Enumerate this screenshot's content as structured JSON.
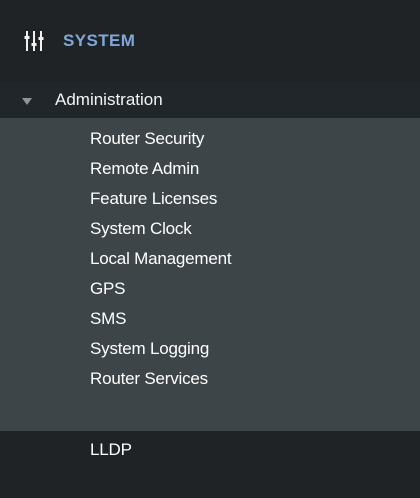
{
  "sidebar": {
    "section_title": "SYSTEM",
    "section_icon": "sliders-icon",
    "group_label": "Administration",
    "items": [
      {
        "label": "Router Security"
      },
      {
        "label": "Remote Admin"
      },
      {
        "label": "Feature Licenses"
      },
      {
        "label": "System Clock"
      },
      {
        "label": "Local Management"
      },
      {
        "label": "GPS"
      },
      {
        "label": "SMS"
      },
      {
        "label": "System Logging"
      },
      {
        "label": "Router Services"
      },
      {
        "label": "LLDP"
      }
    ]
  }
}
